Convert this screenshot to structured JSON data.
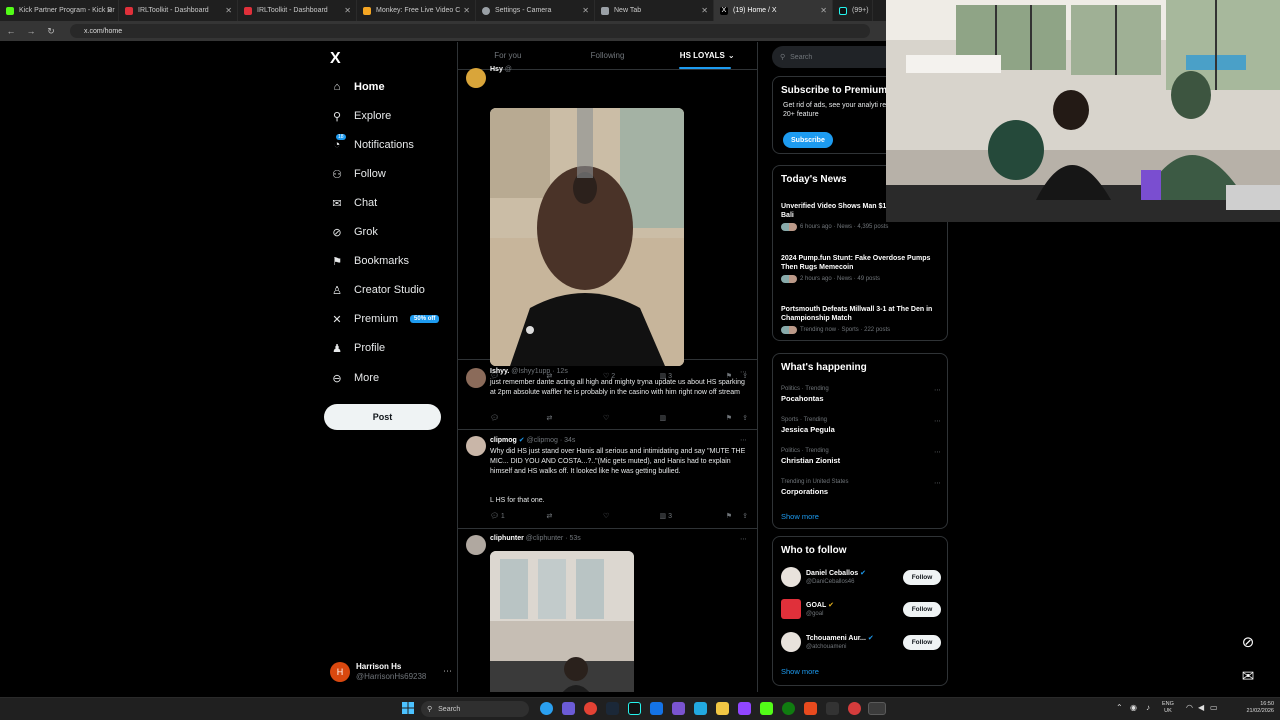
{
  "browser": {
    "tabs": [
      {
        "label": "Kick Partner Program - Kick Dr",
        "color": "#53fc18"
      },
      {
        "label": "IRLToolkit - Dashboard",
        "color": "#e0303a"
      },
      {
        "label": "IRLToolkit - Dashboard",
        "color": "#e0303a"
      },
      {
        "label": "Monkey: Free Live Video C",
        "color": "#f5a623"
      },
      {
        "label": "Settings - Camera",
        "color": "#9aa0a6"
      },
      {
        "label": "New Tab",
        "color": "#9aa0a6"
      },
      {
        "label": "(19) Home / X",
        "color": "#ffffff"
      },
      {
        "label": "(99+) ",
        "color": "#ffffff"
      }
    ],
    "url": "x.com/home"
  },
  "nav": {
    "logo": "X",
    "items": [
      {
        "label": "Home",
        "icon": "home-icon",
        "glyph": "⌂"
      },
      {
        "label": "Explore",
        "icon": "search-icon",
        "glyph": "⚲"
      },
      {
        "label": "Notifications",
        "icon": "bell-icon",
        "glyph": "◔"
      },
      {
        "label": "Follow",
        "icon": "person-add-icon",
        "glyph": "⚇"
      },
      {
        "label": "Chat",
        "icon": "mail-icon",
        "glyph": "✉"
      },
      {
        "label": "Grok",
        "icon": "grok-icon",
        "glyph": "⊘"
      },
      {
        "label": "Bookmarks",
        "icon": "bookmark-icon",
        "glyph": "⚑"
      },
      {
        "label": "Creator Studio",
        "icon": "creator-studio-icon",
        "glyph": "♙"
      },
      {
        "label": "Premium",
        "icon": "x-premium-icon",
        "glyph": "✕"
      },
      {
        "label": "Profile",
        "icon": "profile-icon",
        "glyph": "♟"
      },
      {
        "label": "More",
        "icon": "more-icon",
        "glyph": "⊖"
      }
    ],
    "notifications_badge": "18",
    "premium_badge": "50% off",
    "post_label": "Post",
    "account": {
      "initial": "H",
      "name": "Harrison Hs",
      "handle": "@HarrisonHs69238",
      "more": "⋯"
    }
  },
  "timeline": {
    "tabs": [
      "For you",
      "Following",
      "HS LOYALS"
    ],
    "tweets": [
      {
        "name": "Hsy",
        "handle": "@",
        "time": "",
        "replies": "",
        "reposts": "",
        "likes": "2",
        "views": "3"
      },
      {
        "name": "Ishyy.",
        "handle": "@Ishyy1upp",
        "time": "· 12s",
        "text": "just remember dante acting all high and mighty tryna update us about HS sparking at 2pm absolute waffler he is probably in the casino with him right now off stream",
        "replies": "",
        "reposts": "",
        "likes": "",
        "views": ""
      },
      {
        "name": "clipmog",
        "handle": "@clipmog",
        "time": "· 34s",
        "text": "Why did HS just stand over Hanis all serious and intimidating and say \"MUTE THE MIC... DID YOU AND COSTA...?..\"(Mic gets muted), and Hanis had to explain himself and HS walks off. It looked like he was getting bullied.",
        "text2": "L HS for that one.",
        "replies": "1",
        "reposts": "",
        "likes": "",
        "views": "3"
      },
      {
        "name": "cliphunter",
        "handle": "@cliphunter",
        "time": "· 53s"
      }
    ]
  },
  "sidebar": {
    "search_placeholder": "Search",
    "premium": {
      "title": "Subscribe to Premium",
      "text": "Get rid of ads, see your analyti replies and unlock 20+ feature",
      "button": "Subscribe"
    },
    "news": {
      "title": "Today's News",
      "items": [
        {
          "title": "Unverified Video Shows Man $10M Ransom in Bali",
          "meta": "6 hours ago · News · 4,395 posts"
        },
        {
          "title": "2024 Pump.fun Stunt: Fake Overdose Pumps Then Rugs Memecoin",
          "meta": "2 hours ago · News · 49 posts"
        },
        {
          "title": "Portsmouth Defeats Millwall 3-1 at The Den in Championship Match",
          "meta": "Trending now · Sports · 222 posts"
        }
      ]
    },
    "happening": {
      "title": "What's happening",
      "items": [
        {
          "category": "Politics · Trending",
          "name": "Pocahontas"
        },
        {
          "category": "Sports · Trending",
          "name": "Jessica Pegula"
        },
        {
          "category": "Politics · Trending",
          "name": "Christian Zionist"
        },
        {
          "category": "Trending in United States",
          "name": "Corporations"
        }
      ],
      "show_more": "Show more"
    },
    "who_to_follow": {
      "title": "Who to follow",
      "items": [
        {
          "name": "Daniel Ceballos",
          "handle": "@DaniCeballos46",
          "button": "Follow"
        },
        {
          "name": "GOAL",
          "handle": "@goal",
          "button": "Follow"
        },
        {
          "name": "Tchouameni Aur...",
          "handle": "@atchouameni",
          "button": "Follow"
        }
      ],
      "show_more": "Show more"
    }
  },
  "taskbar": {
    "search": "Search",
    "lang": "ENG\nUK",
    "time": "16:50",
    "date": "21/02/2026"
  }
}
